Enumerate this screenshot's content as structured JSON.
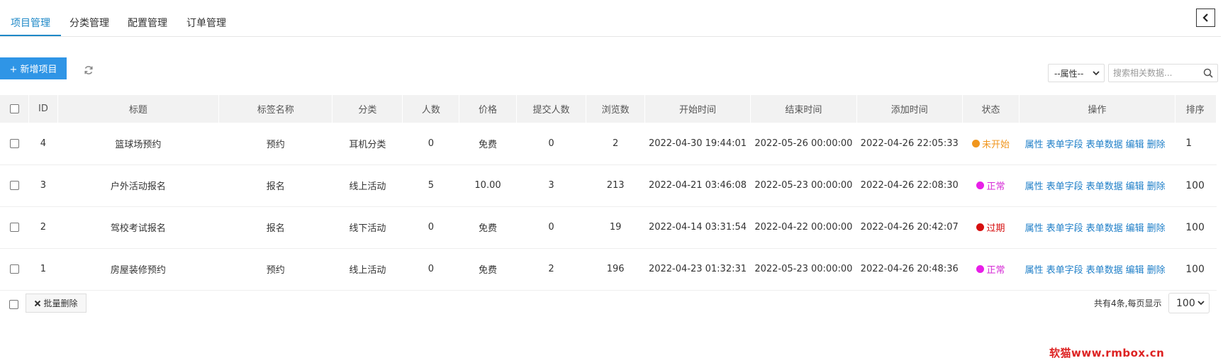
{
  "tabs": [
    {
      "label": "项目管理",
      "active": true
    },
    {
      "label": "分类管理"
    },
    {
      "label": "配置管理"
    },
    {
      "label": "订单管理"
    }
  ],
  "toolbar": {
    "add_label": "+ 新增项目",
    "attr_select_value": "--属性--",
    "search_placeholder": "搜索相关数据..."
  },
  "table": {
    "headers": [
      "ID",
      "标题",
      "标签名称",
      "分类",
      "人数",
      "价格",
      "提交人数",
      "浏览数",
      "开始时间",
      "结束时间",
      "添加时间",
      "状态",
      "操作",
      "排序"
    ],
    "rows": [
      {
        "id": "4",
        "title": "篮球场预约",
        "tag": "预约",
        "category": "耳机分类",
        "people": "0",
        "price": "免费",
        "submitted": "0",
        "views": "2",
        "start": "2022-04-30 19:44:01",
        "end": "2022-05-26 00:00:00",
        "added": "2022-04-26 22:05:33",
        "status": "未开始",
        "status_color": "#f0961e",
        "status_text_color": "#f0961e",
        "sort": "1"
      },
      {
        "id": "3",
        "title": "户外活动报名",
        "tag": "报名",
        "category": "线上活动",
        "people": "5",
        "price": "10.00",
        "submitted": "3",
        "views": "213",
        "start": "2022-04-21 03:46:08",
        "end": "2022-05-23 00:00:00",
        "added": "2022-04-26 22:08:30",
        "status": "正常",
        "status_color": "#e81ee8",
        "status_text_color": "#d62bd6",
        "sort": "100"
      },
      {
        "id": "2",
        "title": "驾校考试报名",
        "tag": "报名",
        "category": "线下活动",
        "people": "0",
        "price": "免费",
        "submitted": "0",
        "views": "19",
        "start": "2022-04-14 03:31:54",
        "end": "2022-04-22 00:00:00",
        "added": "2022-04-26 20:42:07",
        "status": "过期",
        "status_color": "#d60f0f",
        "status_text_color": "#d60f0f",
        "sort": "100"
      },
      {
        "id": "1",
        "title": "房屋装修预约",
        "tag": "预约",
        "category": "线上活动",
        "people": "0",
        "price": "免费",
        "submitted": "2",
        "views": "196",
        "start": "2022-04-23 01:32:31",
        "end": "2022-05-23 00:00:00",
        "added": "2022-04-26 20:48:36",
        "status": "正常",
        "status_color": "#e81ee8",
        "status_text_color": "#d62bd6",
        "sort": "100"
      }
    ],
    "actions": [
      "属性",
      "表单字段",
      "表单数据",
      "编辑",
      "删除"
    ]
  },
  "footer": {
    "batch_delete_label": "批量删除",
    "total_text": "共有4条,每页显示",
    "page_size": "100"
  },
  "watermark": "软猫www.rmbox.cn",
  "colors": {
    "accent": "#1e88c7",
    "primary_button": "#2f95e6",
    "link": "#1f7fc8"
  }
}
